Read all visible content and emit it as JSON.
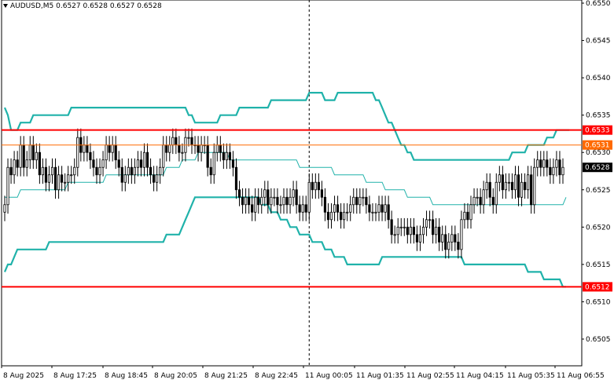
{
  "header": {
    "symbol": "AUDUSD,M5",
    "ohlc": "0.6527 0.6528 0.6527 0.6528"
  },
  "chart_data": {
    "type": "candlestick",
    "title": "AUDUSD,M5",
    "ylim": [
      0.6501,
      0.655
    ],
    "y_ticks": [
      "0.6550",
      "0.6545",
      "0.6540",
      "0.6535",
      "0.6530",
      "0.6525",
      "0.6520",
      "0.6515",
      "0.6510",
      "0.6505"
    ],
    "x_labels": [
      "8 Aug 2025",
      "8 Aug 17:25",
      "8 Aug 18:45",
      "8 Aug 20:05",
      "8 Aug 21:25",
      "8 Aug 22:45",
      "11 Aug 00:05",
      "11 Aug 01:35",
      "11 Aug 02:55",
      "11 Aug 04:15",
      "11 Aug 05:35",
      "11 Aug 06:55"
    ],
    "price_levels": [
      {
        "value": 0.6533,
        "label": "0.6533",
        "color": "#ff0000",
        "style": "thick"
      },
      {
        "value": 0.6531,
        "label": "0.6531",
        "color": "#ff6a00",
        "style": "thin"
      },
      {
        "value": 0.6512,
        "label": "0.6512",
        "color": "#ff0000",
        "style": "thick"
      }
    ],
    "current_price": {
      "value": 0.6528,
      "label": "0.6528"
    },
    "session_separator_at_bar": 96,
    "colors": {
      "candle": "#000000",
      "bands": "#20b2aa",
      "level_red": "#ff0000",
      "level_orange": "#ff6a00"
    },
    "closes": [
      0.6523,
      0.6528,
      0.6527,
      0.6529,
      0.6528,
      0.6531,
      0.6528,
      0.6529,
      0.6531,
      0.6529,
      0.653,
      0.6527,
      0.6528,
      0.6526,
      0.6527,
      0.6528,
      0.6525,
      0.6527,
      0.6526,
      0.6526,
      0.6527,
      0.6527,
      0.6528,
      0.6532,
      0.653,
      0.6531,
      0.653,
      0.6529,
      0.6528,
      0.6527,
      0.6528,
      0.6529,
      0.6531,
      0.653,
      0.6531,
      0.6529,
      0.6528,
      0.6526,
      0.6527,
      0.6528,
      0.6527,
      0.6528,
      0.6529,
      0.6528,
      0.653,
      0.6528,
      0.6527,
      0.6526,
      0.6527,
      0.6528,
      0.6531,
      0.653,
      0.6531,
      0.6532,
      0.6531,
      0.653,
      0.653,
      0.6532,
      0.6532,
      0.6531,
      0.6531,
      0.653,
      0.6531,
      0.6531,
      0.6528,
      0.6527,
      0.653,
      0.6531,
      0.653,
      0.6529,
      0.653,
      0.6529,
      0.6528,
      0.6525,
      0.6524,
      0.6523,
      0.6524,
      0.6523,
      0.6522,
      0.6524,
      0.6523,
      0.6524,
      0.6525,
      0.6523,
      0.6524,
      0.6524,
      0.6523,
      0.6523,
      0.6524,
      0.6523,
      0.6524,
      0.6525,
      0.6523,
      0.6522,
      0.6523,
      0.6522,
      0.6526,
      0.6525,
      0.6526,
      0.6525,
      0.6524,
      0.6522,
      0.6521,
      0.6522,
      0.6523,
      0.6522,
      0.6521,
      0.6522,
      0.6522,
      0.6523,
      0.6524,
      0.6523,
      0.6524,
      0.6524,
      0.6523,
      0.6522,
      0.6522,
      0.6522,
      0.6523,
      0.6522,
      0.6523,
      0.6521,
      0.6519,
      0.6519,
      0.652,
      0.652,
      0.652,
      0.6519,
      0.652,
      0.6519,
      0.6518,
      0.6519,
      0.652,
      0.6521,
      0.6521,
      0.6519,
      0.652,
      0.6518,
      0.6519,
      0.6517,
      0.6518,
      0.6519,
      0.6518,
      0.6517,
      0.6521,
      0.6522,
      0.6521,
      0.6523,
      0.6524,
      0.6524,
      0.6523,
      0.6525,
      0.6526,
      0.6524,
      0.6523,
      0.6526,
      0.6527,
      0.6525,
      0.6526,
      0.6526,
      0.6525,
      0.6527,
      0.6524,
      0.6526,
      0.6525,
      0.6527,
      0.6523,
      0.6528,
      0.6529,
      0.6528,
      0.6529,
      0.6528,
      0.6527,
      0.6528,
      0.6529,
      0.6527,
      0.6528
    ],
    "upper_band": [
      0.6536,
      0.6535,
      0.6533,
      0.6533,
      0.6533,
      0.6534,
      0.6534,
      0.6534,
      0.6534,
      0.6535,
      0.6535,
      0.6535,
      0.6535,
      0.6535,
      0.6535,
      0.6535,
      0.6535,
      0.6535,
      0.6535,
      0.6535,
      0.6535,
      0.6536,
      0.6536,
      0.6536,
      0.6536,
      0.6536,
      0.6536,
      0.6536,
      0.6536,
      0.6536,
      0.6536,
      0.6536,
      0.6536,
      0.6536,
      0.6536,
      0.6536,
      0.6536,
      0.6536,
      0.6536,
      0.6536,
      0.6536,
      0.6536,
      0.6536,
      0.6536,
      0.6536,
      0.6536,
      0.6536,
      0.6536,
      0.6536,
      0.6536,
      0.6536,
      0.6536,
      0.6536,
      0.6536,
      0.6536,
      0.6536,
      0.6536,
      0.6536,
      0.6535,
      0.6535,
      0.6534,
      0.6534,
      0.6534,
      0.6534,
      0.6534,
      0.6534,
      0.6534,
      0.6534,
      0.6535,
      0.6535,
      0.6535,
      0.6535,
      0.6535,
      0.6535,
      0.6536,
      0.6536,
      0.6536,
      0.6536,
      0.6536,
      0.6536,
      0.6536,
      0.6536,
      0.6536,
      0.6536,
      0.6537,
      0.6537,
      0.6537,
      0.6537,
      0.6537,
      0.6537,
      0.6537,
      0.6537,
      0.6537,
      0.6537,
      0.6537,
      0.6537,
      0.6538,
      0.6538,
      0.6538,
      0.6538,
      0.6538,
      0.6537,
      0.6537,
      0.6537,
      0.6537,
      0.6538,
      0.6538,
      0.6538,
      0.6538,
      0.6538,
      0.6538,
      0.6538,
      0.6538,
      0.6538,
      0.6538,
      0.6538,
      0.6538,
      0.6537,
      0.6537,
      0.6536,
      0.6535,
      0.6534,
      0.6534,
      0.6533,
      0.6532,
      0.6531,
      0.6531,
      0.653,
      0.653,
      0.6529,
      0.6529,
      0.6529,
      0.6529,
      0.6529,
      0.6529,
      0.6529,
      0.6529,
      0.6529,
      0.6529,
      0.6529,
      0.6529,
      0.6529,
      0.6529,
      0.6529,
      0.6529,
      0.6529,
      0.6529,
      0.6529,
      0.6529,
      0.6529,
      0.6529,
      0.6529,
      0.6529,
      0.6529,
      0.6529,
      0.6529,
      0.6529,
      0.6529,
      0.6529,
      0.6529,
      0.653,
      0.653,
      0.653,
      0.653,
      0.653,
      0.6531,
      0.6531,
      0.6531,
      0.6531,
      0.6531,
      0.6531,
      0.6532,
      0.6532,
      0.6532,
      0.6533,
      0.6533,
      0.6533,
      0.6533,
      0.6533
    ],
    "middle_band": [
      0.6524,
      0.6524,
      0.6524,
      0.6524,
      0.6524,
      0.6525,
      0.6525,
      0.6525,
      0.6525,
      0.6525,
      0.6525,
      0.6525,
      0.6525,
      0.6525,
      0.6525,
      0.6525,
      0.6525,
      0.6525,
      0.6525,
      0.6525,
      0.6526,
      0.6526,
      0.6526,
      0.6526,
      0.6526,
      0.6526,
      0.6526,
      0.6526,
      0.6526,
      0.6526,
      0.6526,
      0.6526,
      0.6527,
      0.6527,
      0.6527,
      0.6527,
      0.6527,
      0.6527,
      0.6527,
      0.6527,
      0.6527,
      0.6527,
      0.6527,
      0.6527,
      0.6527,
      0.6527,
      0.6527,
      0.6527,
      0.6527,
      0.6527,
      0.6527,
      0.6528,
      0.6528,
      0.6528,
      0.6528,
      0.6528,
      0.6529,
      0.6529,
      0.6529,
      0.6529,
      0.6529,
      0.653,
      0.653,
      0.653,
      0.653,
      0.653,
      0.653,
      0.653,
      0.653,
      0.653,
      0.653,
      0.6529,
      0.6529,
      0.6529,
      0.6529,
      0.6529,
      0.6529,
      0.6529,
      0.6529,
      0.6529,
      0.6529,
      0.6529,
      0.6529,
      0.6529,
      0.6529,
      0.6529,
      0.6529,
      0.6529,
      0.6529,
      0.6529,
      0.6529,
      0.6529,
      0.6529,
      0.6528,
      0.6528,
      0.6528,
      0.6528,
      0.6528,
      0.6528,
      0.6528,
      0.6528,
      0.6528,
      0.6528,
      0.6528,
      0.6527,
      0.6527,
      0.6527,
      0.6527,
      0.6527,
      0.6527,
      0.6527,
      0.6527,
      0.6527,
      0.6527,
      0.6526,
      0.6526,
      0.6526,
      0.6526,
      0.6526,
      0.6526,
      0.6525,
      0.6525,
      0.6525,
      0.6525,
      0.6525,
      0.6525,
      0.6525,
      0.6524,
      0.6524,
      0.6524,
      0.6524,
      0.6524,
      0.6524,
      0.6524,
      0.6524,
      0.6523,
      0.6523,
      0.6523,
      0.6523,
      0.6523,
      0.6523,
      0.6523,
      0.6523,
      0.6523,
      0.6523,
      0.6523,
      0.6523,
      0.6523,
      0.6523,
      0.6523,
      0.6523,
      0.6523,
      0.6523,
      0.6523,
      0.6523,
      0.6523,
      0.6523,
      0.6523,
      0.6523,
      0.6523,
      0.6523,
      0.6523,
      0.6523,
      0.6523,
      0.6523,
      0.6523,
      0.6523,
      0.6523,
      0.6523,
      0.6523,
      0.6523,
      0.6523,
      0.6523,
      0.6523,
      0.6523,
      0.6523,
      0.6523,
      0.6524
    ],
    "lower_band": [
      0.6514,
      0.6515,
      0.6515,
      0.6516,
      0.6517,
      0.6517,
      0.6517,
      0.6517,
      0.6517,
      0.6517,
      0.6517,
      0.6517,
      0.6517,
      0.6517,
      0.6518,
      0.6518,
      0.6518,
      0.6518,
      0.6518,
      0.6518,
      0.6518,
      0.6518,
      0.6518,
      0.6518,
      0.6518,
      0.6518,
      0.6518,
      0.6518,
      0.6518,
      0.6518,
      0.6518,
      0.6518,
      0.6518,
      0.6518,
      0.6518,
      0.6518,
      0.6518,
      0.6518,
      0.6518,
      0.6518,
      0.6518,
      0.6518,
      0.6518,
      0.6518,
      0.6518,
      0.6518,
      0.6518,
      0.6518,
      0.6518,
      0.6518,
      0.6518,
      0.6519,
      0.6519,
      0.6519,
      0.6519,
      0.6519,
      0.652,
      0.6521,
      0.6522,
      0.6523,
      0.6524,
      0.6524,
      0.6524,
      0.6524,
      0.6524,
      0.6524,
      0.6524,
      0.6524,
      0.6524,
      0.6524,
      0.6524,
      0.6524,
      0.6524,
      0.6524,
      0.6524,
      0.6524,
      0.6524,
      0.6524,
      0.6524,
      0.6524,
      0.6524,
      0.6523,
      0.6523,
      0.6523,
      0.6522,
      0.6522,
      0.6522,
      0.6521,
      0.6521,
      0.6521,
      0.652,
      0.652,
      0.652,
      0.6519,
      0.6519,
      0.6519,
      0.6519,
      0.6518,
      0.6518,
      0.6518,
      0.6518,
      0.6517,
      0.6517,
      0.6517,
      0.6516,
      0.6516,
      0.6516,
      0.6516,
      0.6515,
      0.6515,
      0.6515,
      0.6515,
      0.6515,
      0.6515,
      0.6515,
      0.6515,
      0.6515,
      0.6515,
      0.6515,
      0.6516,
      0.6516,
      0.6516,
      0.6516,
      0.6516,
      0.6516,
      0.6516,
      0.6516,
      0.6516,
      0.6516,
      0.6516,
      0.6516,
      0.6516,
      0.6516,
      0.6516,
      0.6516,
      0.6516,
      0.6516,
      0.6516,
      0.6516,
      0.6516,
      0.6516,
      0.6516,
      0.6516,
      0.6516,
      0.6516,
      0.6515,
      0.6515,
      0.6515,
      0.6515,
      0.6515,
      0.6515,
      0.6515,
      0.6515,
      0.6515,
      0.6515,
      0.6515,
      0.6515,
      0.6515,
      0.6515,
      0.6515,
      0.6515,
      0.6515,
      0.6515,
      0.6515,
      0.6515,
      0.6514,
      0.6514,
      0.6514,
      0.6514,
      0.6514,
      0.6513,
      0.6513,
      0.6513,
      0.6513,
      0.6513,
      0.6513,
      0.6512,
      0.6512
    ]
  }
}
